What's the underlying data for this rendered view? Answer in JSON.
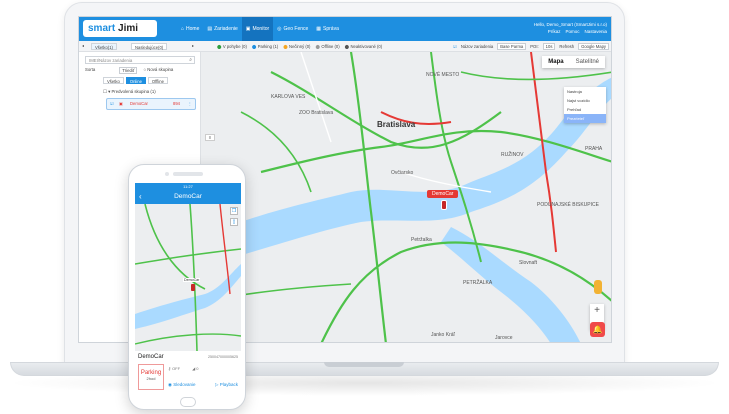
{
  "app": {
    "logo_text": "smart",
    "logo_bold": "Jimi"
  },
  "nav": [
    {
      "icon": "home-icon",
      "label": "Home"
    },
    {
      "icon": "devices-icon",
      "label": "Zariadenie"
    },
    {
      "icon": "monitor-icon",
      "label": "Monitor"
    },
    {
      "icon": "geofence-icon",
      "label": "Geo Fence"
    },
    {
      "icon": "report-icon",
      "label": "Správa"
    }
  ],
  "user": {
    "greeting": "Hello,",
    "name": "Demo_Smart (SmartJimi s.r.o)",
    "actions": [
      "Príkaz",
      "Pomoc",
      "Nastavenia"
    ]
  },
  "filterbar": {
    "tab_all": "Všetko(1)",
    "tab_subaccounts": "Nasledujúce(0)",
    "status": [
      {
        "label": "V pohybe (0)",
        "color": "#2e9e3f"
      },
      {
        "label": "Parking (1)",
        "color": "#1e8fe0"
      },
      {
        "label": "Nečinný (0)",
        "color": "#f5a623"
      },
      {
        "label": "Offline (0)",
        "color": "#999999"
      },
      {
        "label": "Neaktivované (0)",
        "color": "#555555"
      }
    ],
    "show_device_name": "Názov zariadenia",
    "base_parma": "Base Parma",
    "poi": "POI:",
    "refresh_select": "10s",
    "refresh_label": "Refresh",
    "map_select": "Google Mapy"
  },
  "sidepanel": {
    "search_placeholder": "IMEI/Názov zariadenia",
    "sort_label": "Sorta",
    "sort_select": "Triediť",
    "new_group": "Nová skupina",
    "chips": [
      {
        "label": "Všetko",
        "active": false
      },
      {
        "label": "Online",
        "active": true
      },
      {
        "label": "Offline",
        "active": false
      }
    ],
    "group_label": "Predvolená skupina",
    "group_count": "(1)",
    "device": {
      "name": "DemoCar",
      "id": "894"
    }
  },
  "map": {
    "tab_map": "Mapa",
    "tab_satellite": "Satelitné",
    "legend": [
      "Nastroja",
      "Najst vozidlo",
      "Prehľad",
      "Prezrieteľ"
    ],
    "city": "Bratislava",
    "car_label": "DemoCar",
    "labels": [
      "KARLOVA VES",
      "ZOO Bratislava",
      "NOVÉ MESTO",
      "Petržalka",
      "PRAHA",
      "RUŽINOV",
      "PODUNAJSKÉ BISKUPICE",
      "Janko Kráľ",
      "Ovčiarsko",
      "PETRŽALKA",
      "Slovnaft",
      "Jarovce"
    ],
    "zoom_in": "+",
    "zoom_out": "−"
  },
  "phone": {
    "status_time": "11:27",
    "title": "DemoCar",
    "map_label": "DemoCar",
    "device_title": "DemoCar",
    "device_id": "250047000005625",
    "parking": "Parking",
    "duration": "2hod",
    "acc": "OFF",
    "signal": "0",
    "action_left": "Sledovanie",
    "action_right": "Playback"
  }
}
